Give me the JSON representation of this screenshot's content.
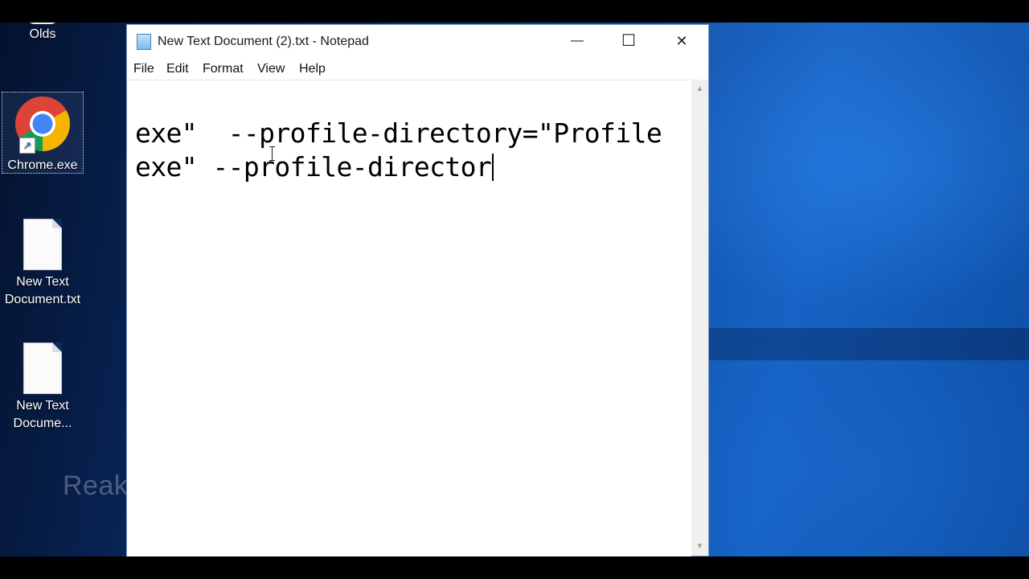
{
  "desktop": {
    "icons": [
      {
        "label": "Olds"
      },
      {
        "label": "Chrome.exe"
      },
      {
        "label_line1": "New Text",
        "label_line2": "Document.txt"
      },
      {
        "label_line1": "New Text",
        "label_line2": "Docume..."
      }
    ],
    "watermark": "Reakerneg Dutner"
  },
  "window": {
    "title": "New Text Document (2).txt - Notepad",
    "controls": {
      "minimize": "—",
      "maximize": "☐",
      "close": "✕"
    },
    "menu": [
      "File",
      "Edit",
      "Format",
      "View",
      "Help"
    ],
    "editor": {
      "lines": [
        "exe\"  --profile-directory=\"Profile",
        "exe\" --profile-director"
      ]
    }
  },
  "colors": {
    "desktop_blue": "#0d4aa2",
    "window_bg": "#ffffff",
    "text": "#000000"
  }
}
